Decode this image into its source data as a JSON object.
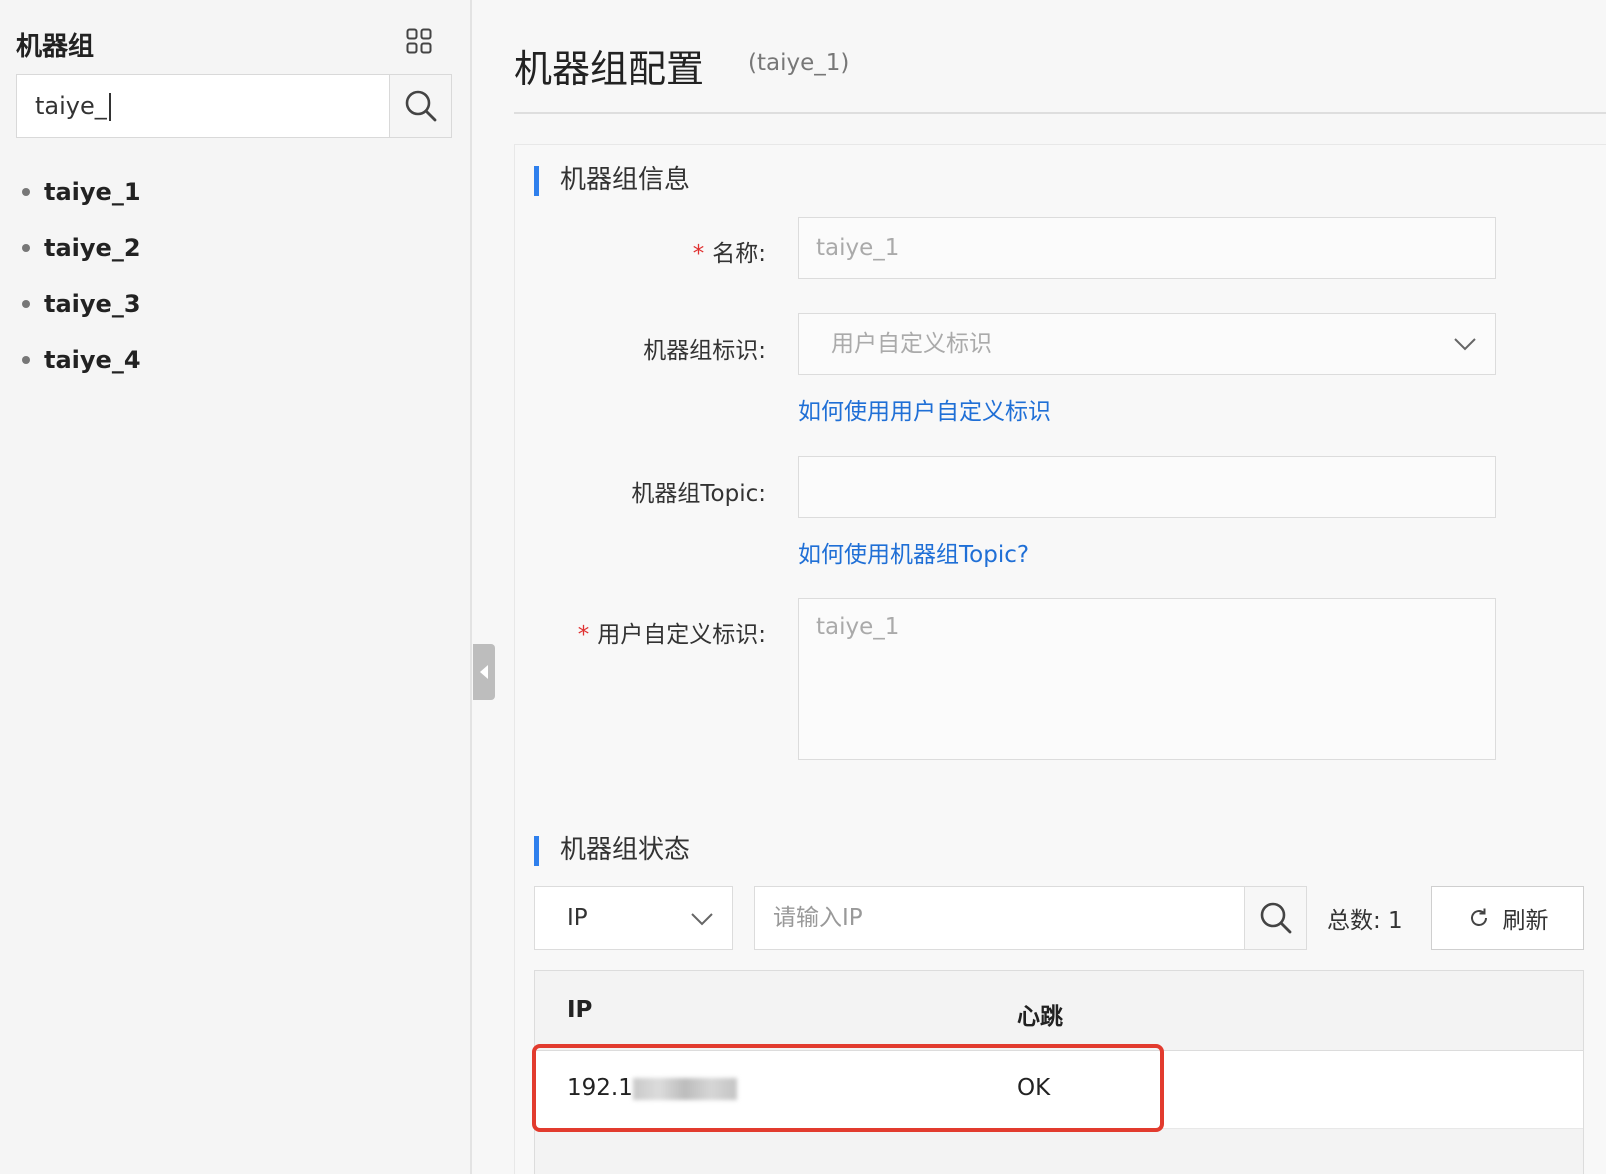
{
  "sidebar": {
    "title": "机器组",
    "search_value": "taiye_",
    "groups": [
      "taiye_1",
      "taiye_2",
      "taiye_3",
      "taiye_4"
    ]
  },
  "header": {
    "title": "机器组配置",
    "subtitle": "(taiye_1)"
  },
  "info_section": {
    "title": "机器组信息",
    "name_label": "名称:",
    "name_value": "taiye_1",
    "identifier_label": "机器组标识:",
    "identifier_value": "用户自定义标识",
    "identifier_help_link": "如何使用用户自定义标识",
    "topic_label": "机器组Topic:",
    "topic_value": "",
    "topic_help_link": "如何使用机器组Topic?",
    "custom_id_label": "用户自定义标识:",
    "custom_id_value": "taiye_1",
    "required_mark": "*"
  },
  "status_section": {
    "title": "机器组状态",
    "filter_select": "IP",
    "search_placeholder": "请输入IP",
    "total_label": "总数: 1",
    "refresh_label": "刷新",
    "columns": [
      "IP",
      "心跳"
    ],
    "rows": [
      {
        "ip_prefix": "192.1",
        "heartbeat": "OK"
      }
    ]
  },
  "colors": {
    "accent": "#2f80ed",
    "link": "#1f6fd6",
    "required": "#e03131",
    "highlight_border": "#e23b2e"
  }
}
